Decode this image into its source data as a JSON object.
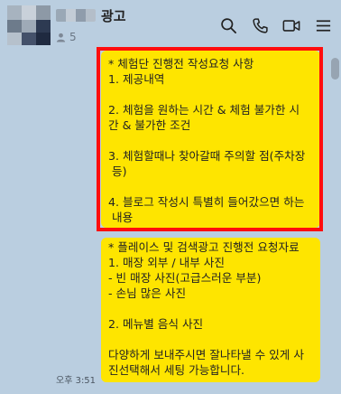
{
  "header": {
    "title": "광고",
    "member_count": "5"
  },
  "messages": [
    {
      "text": "* 체험단 진행전 작성요청 사항\n1. 제공내역\n\n2. 체험을 원하는 시간 & 체험 불가한 시\n간 & 불가한 조건\n\n3. 체험할때나 찾아갈때 주의할 점(주차장\n 등)\n\n4. 블로그 작성시 특별히 들어갔으면 하는\n 내용"
    },
    {
      "text": "* 플레이스 및 검색광고 진행전 요청자료\n1. 매장 외부 / 내부 사진\n- 빈 매장 사진(고급스러운 부분)\n- 손님 많은 사진\n\n2. 메뉴별 음식 사진\n\n다양하게 보내주시면 잘나타낼 수 있게 사\n진선택해서 세팅 가능합니다.",
      "time": "오후 3:51"
    }
  ],
  "colors": {
    "bubble": "#fee500",
    "background": "#bacee0",
    "highlight": "#ff0d0d"
  },
  "icons": [
    "search-icon",
    "phone-icon",
    "video-icon",
    "menu-icon",
    "person-icon"
  ]
}
